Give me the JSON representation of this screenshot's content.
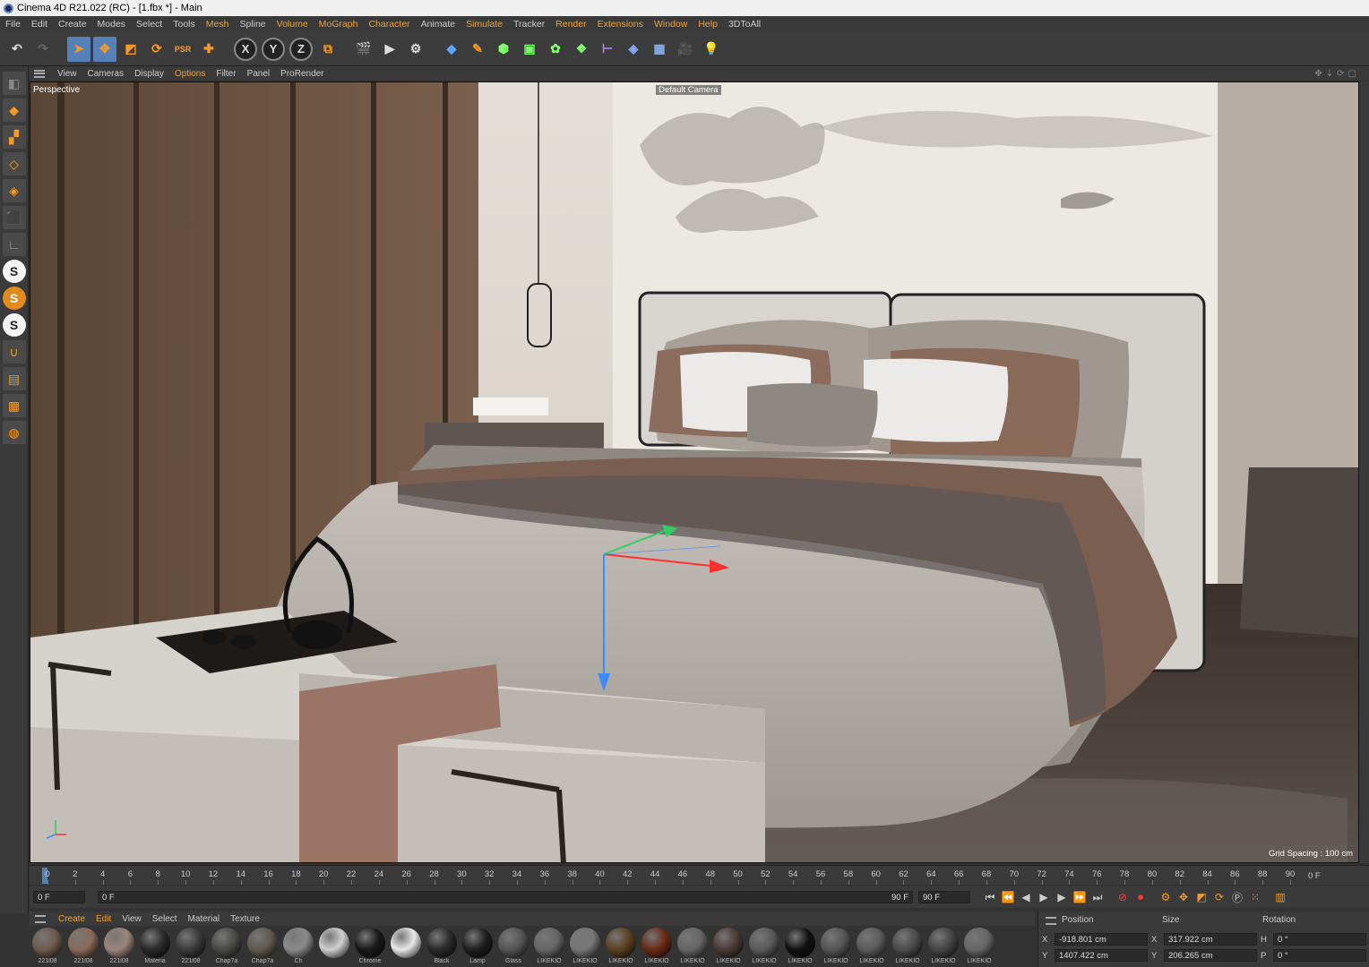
{
  "window": {
    "title": "Cinema 4D R21.022 (RC) - [1.fbx *] - Main"
  },
  "menu": [
    "File",
    "Edit",
    "Create",
    "Modes",
    "Select",
    "Tools",
    "Mesh",
    "Spline",
    "Volume",
    "MoGraph",
    "Character",
    "Animate",
    "Simulate",
    "Tracker",
    "Render",
    "Extensions",
    "Window",
    "Help",
    "3DToAll"
  ],
  "viewport_menu": [
    "View",
    "Cameras",
    "Display",
    "Options",
    "Filter",
    "Panel",
    "ProRender"
  ],
  "viewport": {
    "label": "Perspective",
    "camera": "Default Camera",
    "grid_spacing": "Grid Spacing : 100 cm"
  },
  "axes": {
    "x": "X",
    "y": "Y",
    "z": "Z"
  },
  "timeline": {
    "ticks": [
      "0",
      "2",
      "4",
      "6",
      "8",
      "10",
      "12",
      "14",
      "16",
      "18",
      "20",
      "22",
      "24",
      "26",
      "28",
      "30",
      "32",
      "34",
      "36",
      "38",
      "40",
      "42",
      "44",
      "46",
      "48",
      "50",
      "52",
      "54",
      "56",
      "58",
      "60",
      "62",
      "64",
      "66",
      "68",
      "70",
      "72",
      "74",
      "76",
      "78",
      "80",
      "82",
      "84",
      "86",
      "88",
      "90"
    ],
    "current": "0 F"
  },
  "transport": {
    "start": "0 F",
    "range_start": "0 F",
    "range_end": "90 F",
    "end": "90 F"
  },
  "material_menu": [
    "Create",
    "Edit",
    "View",
    "Select",
    "Material",
    "Texture"
  ],
  "materials": [
    {
      "name": "221l08",
      "color": "#6e5a4c"
    },
    {
      "name": "221l08",
      "color": "#8a6a58"
    },
    {
      "name": "221l08",
      "color": "#9a8478"
    },
    {
      "name": "Materia",
      "color": "#2a2a2a"
    },
    {
      "name": "221l08",
      "color": "#3a3a3a"
    },
    {
      "name": "Chap7a",
      "color": "#4a4a44"
    },
    {
      "name": "Chap7a",
      "color": "#5e5a50"
    },
    {
      "name": "Ch",
      "color": "#8a8a8a"
    },
    {
      "name": "",
      "color": "#cfcfcf"
    },
    {
      "name": "Chrome",
      "color": "#1a1a1a"
    },
    {
      "name": "",
      "color": "#e8e8e8"
    },
    {
      "name": "Black",
      "color": "#2a2a2a"
    },
    {
      "name": "Lamp",
      "color": "#1e1e1e"
    },
    {
      "name": "Glass",
      "color": "#555"
    },
    {
      "name": "LIKEKIO",
      "color": "#666"
    },
    {
      "name": "LIKEKIO",
      "color": "#777"
    },
    {
      "name": "LIKEKIO",
      "color": "#5a4020"
    },
    {
      "name": "LIKEKIO",
      "color": "#6a2a14"
    },
    {
      "name": "LIKEKIO",
      "color": "#666"
    },
    {
      "name": "LIKEKIO",
      "color": "#4a3a34"
    },
    {
      "name": "LIKEKIO",
      "color": "#5a5a5a"
    },
    {
      "name": "LIKEKIO",
      "color": "#111"
    },
    {
      "name": "LIKEKIO",
      "color": "#555"
    },
    {
      "name": "LIKEKIO",
      "color": "#5a5a5a"
    },
    {
      "name": "LIKEKIO",
      "color": "#4a4a4a"
    },
    {
      "name": "LIKEKIO",
      "color": "#444"
    },
    {
      "name": "LIKEKIO",
      "color": "#666"
    }
  ],
  "coordinates": {
    "headers": {
      "position": "Position",
      "size": "Size",
      "rotation": "Rotation"
    },
    "rows": [
      {
        "axis": "X",
        "position": "-918.801 cm",
        "size_axis": "X",
        "size": "317.922 cm",
        "rot_axis": "H",
        "rotation": "0 °"
      },
      {
        "axis": "Y",
        "position": "1407.422 cm",
        "size_axis": "Y",
        "size": "206.265 cm",
        "rot_axis": "P",
        "rotation": "0 °"
      }
    ]
  },
  "colors": {
    "accent": "#f0a030",
    "selection": "#5580b8"
  }
}
